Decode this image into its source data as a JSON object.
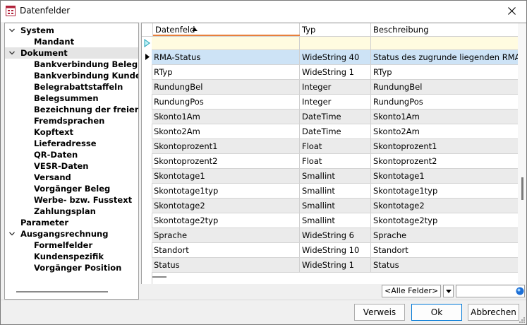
{
  "window": {
    "title": "Datenfelder"
  },
  "tree": {
    "items": [
      {
        "label": "System",
        "level": 0,
        "expanded": true
      },
      {
        "label": "Mandant",
        "level": 1
      },
      {
        "label": "Dokument",
        "level": 0,
        "expanded": true,
        "selected": true
      },
      {
        "label": "Bankverbindung Beleg",
        "level": 1
      },
      {
        "label": "Bankverbindung Kunde",
        "level": 1
      },
      {
        "label": "Belegrabattstaffeln",
        "level": 1
      },
      {
        "label": "Belegsummen",
        "level": 1
      },
      {
        "label": "Bezeichnung der freien Fe",
        "level": 1
      },
      {
        "label": "Fremdsprachen",
        "level": 1
      },
      {
        "label": "Kopftext",
        "level": 1
      },
      {
        "label": "Lieferadresse",
        "level": 1
      },
      {
        "label": "QR-Daten",
        "level": 1
      },
      {
        "label": "VESR-Daten",
        "level": 1
      },
      {
        "label": "Versand",
        "level": 1
      },
      {
        "label": "Vorgänger Beleg",
        "level": 1
      },
      {
        "label": "Werbe- bzw. Fusstext",
        "level": 1
      },
      {
        "label": "Zahlungsplan",
        "level": 1
      },
      {
        "label": "Parameter",
        "level": 0
      },
      {
        "label": "Ausgangsrechnung",
        "level": 0,
        "expanded": true
      },
      {
        "label": "Formelfelder",
        "level": 1
      },
      {
        "label": "Kundenspezifik",
        "level": 1
      },
      {
        "label": "Vorgänger Position",
        "level": 1
      }
    ]
  },
  "grid": {
    "columns": [
      "Datenfeld",
      "Typ",
      "Beschreibung"
    ],
    "rows": [
      {
        "feld": "",
        "typ": "",
        "beschreibung": "",
        "kind": "new"
      },
      {
        "feld": "RMA-Status",
        "typ": "WideString  40",
        "beschreibung": "Status des zugrunde liegenden RMA-Vorgangs",
        "kind": "sel"
      },
      {
        "feld": "RTyp",
        "typ": "WideString  1",
        "beschreibung": "RTyp"
      },
      {
        "feld": "RundungBel",
        "typ": "Integer",
        "beschreibung": "RundungBel"
      },
      {
        "feld": "RundungPos",
        "typ": "Integer",
        "beschreibung": "RundungPos"
      },
      {
        "feld": "Skonto1Am",
        "typ": "DateTime",
        "beschreibung": "Skonto1Am"
      },
      {
        "feld": "Skonto2Am",
        "typ": "DateTime",
        "beschreibung": "Skonto2Am"
      },
      {
        "feld": "Skontoprozent1",
        "typ": "Float",
        "beschreibung": "Skontoprozent1"
      },
      {
        "feld": "Skontoprozent2",
        "typ": "Float",
        "beschreibung": "Skontoprozent2"
      },
      {
        "feld": "Skontotage1",
        "typ": "Smallint",
        "beschreibung": "Skontotage1"
      },
      {
        "feld": "Skontotage1typ",
        "typ": "Smallint",
        "beschreibung": "Skontotage1typ"
      },
      {
        "feld": "Skontotage2",
        "typ": "Smallint",
        "beschreibung": "Skontotage2"
      },
      {
        "feld": "Skontotage2typ",
        "typ": "Smallint",
        "beschreibung": "Skontotage2typ"
      },
      {
        "feld": "Sprache",
        "typ": "WideString  6",
        "beschreibung": "Sprache"
      },
      {
        "feld": "Standort",
        "typ": "WideString  10",
        "beschreibung": "Standort"
      },
      {
        "feld": "Status",
        "typ": "WideString  1",
        "beschreibung": "Status"
      }
    ]
  },
  "filter": {
    "selected": "<Alle Felder>",
    "value": ""
  },
  "buttons": {
    "verweis": "Verweis",
    "ok": "Ok",
    "abbrechen": "Abbrechen"
  },
  "colors": {
    "selection": "#cde3f6",
    "new_row": "#fffbe0",
    "sort_accent": "#e87f3a",
    "default_button_border": "#0078d7"
  }
}
